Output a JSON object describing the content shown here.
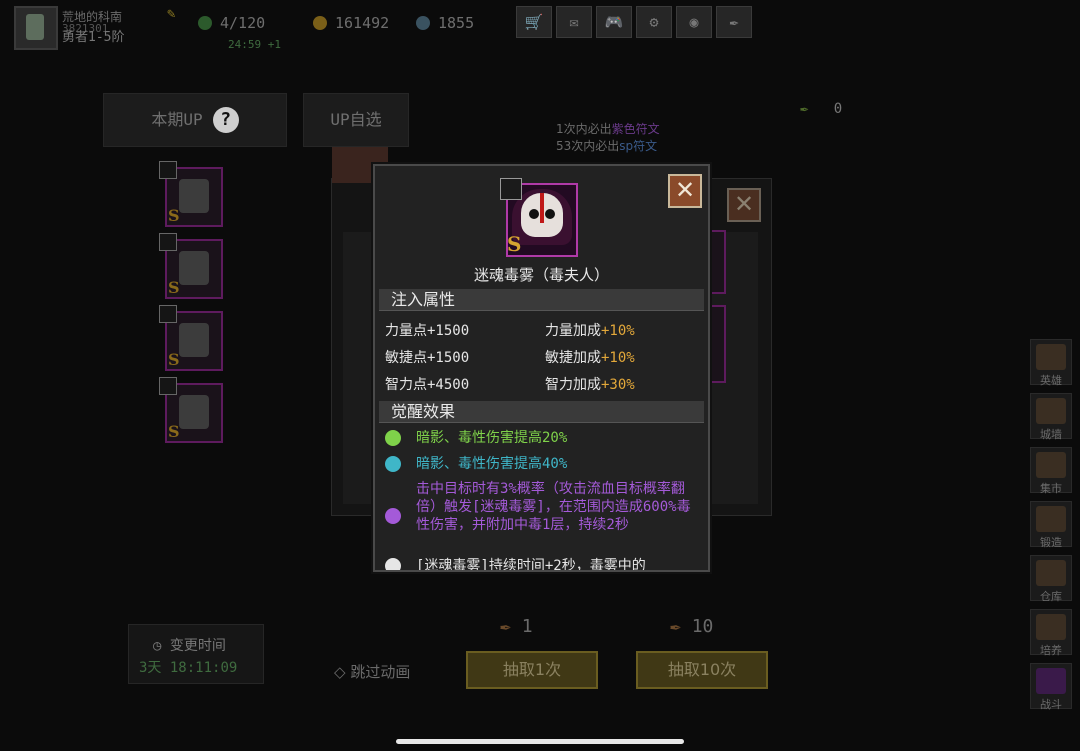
{
  "player": {
    "name": "荒地的科南",
    "uid": "3821301",
    "rank": "勇者1-5阶"
  },
  "stats": {
    "energy": "4/120",
    "energy_timer": "24:59 +1",
    "gold": "161492",
    "gems": "1855"
  },
  "tabs": {
    "current_up": "本期UP",
    "help": "?",
    "up_select": "UP自选"
  },
  "currency_count": "0",
  "guarantee": {
    "line1_prefix": "1次内必出",
    "line1_highlight": "紫色符文",
    "line2_prefix": "53次内必出",
    "line2_highlight": "sp符文"
  },
  "right_nav": [
    "英雄",
    "城墙",
    "集市",
    "锻造",
    "仓库",
    "培养",
    "战斗"
  ],
  "change_time": {
    "label": "变更时间",
    "days": "3天",
    "clock": "18:11:09"
  },
  "skip_anim": "跳过动画",
  "draws": [
    {
      "cost": "1",
      "label": "抽取1次"
    },
    {
      "cost": "10",
      "label": "抽取10次"
    }
  ],
  "modal": {
    "rank_letter": "S",
    "item_name": "迷魂毒雾（毒夫人）",
    "section_inject": "注入属性",
    "attrs": [
      {
        "left_name": "力量点",
        "left_val": "+1500",
        "right_name": "力量加成",
        "right_val": "+10%"
      },
      {
        "left_name": "敏捷点",
        "left_val": "+1500",
        "right_name": "敏捷加成",
        "right_val": "+10%"
      },
      {
        "left_name": "智力点",
        "left_val": "+4500",
        "right_name": "智力加成",
        "right_val": "+30%"
      }
    ],
    "section_awaken": "觉醒效果",
    "effects": [
      {
        "text": "暗影、毒性伤害提高20%",
        "color": "#7fd24a"
      },
      {
        "text": "暗影、毒性伤害提高40%",
        "color": "#3fb6c8"
      },
      {
        "text": "击中目标时有3%概率（攻击流血目标概率翻倍）触发[迷魂毒雾]，在范围内造成600%毒性伤害，并附加中毒1层，持续2秒",
        "color": "#a45ad8"
      },
      {
        "text": "[迷魂毒雾]持续时间+2秒，毒雾中的",
        "color": "#e6e6e6"
      }
    ],
    "slot_rank_letter": "S"
  }
}
